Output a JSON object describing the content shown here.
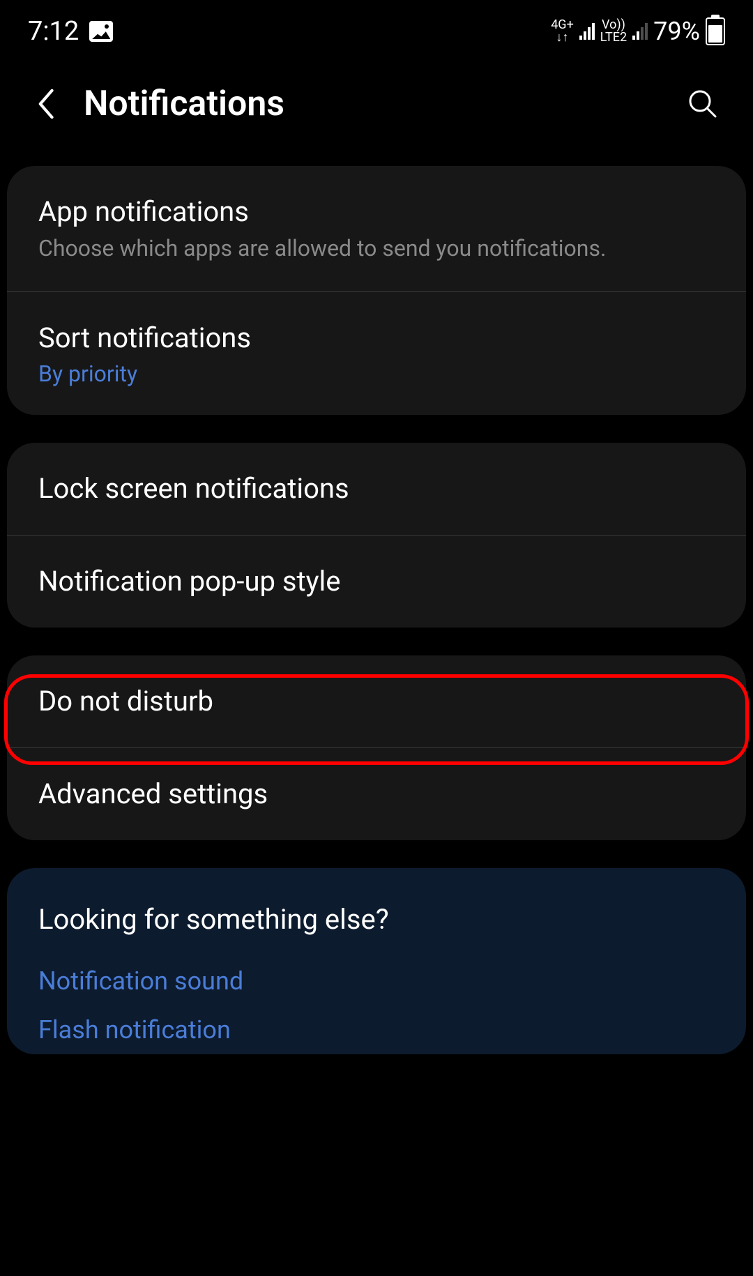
{
  "statusbar": {
    "time": "7:12",
    "network1_label": "4G+",
    "network2_label_top": "Vo))",
    "network2_label_bottom": "LTE2",
    "battery": "79%"
  },
  "header": {
    "title": "Notifications"
  },
  "groups": [
    {
      "items": [
        {
          "title": "App notifications",
          "desc": "Choose which apps are allowed to send you notifications."
        },
        {
          "title": "Sort notifications",
          "value": "By priority"
        }
      ]
    },
    {
      "items": [
        {
          "title": "Lock screen notifications"
        },
        {
          "title": "Notification pop-up style"
        }
      ]
    },
    {
      "items": [
        {
          "title": "Do not disturb"
        },
        {
          "title": "Advanced settings"
        }
      ]
    }
  ],
  "suggestion": {
    "title": "Looking for something else?",
    "links": [
      "Notification sound",
      "Flash notification"
    ]
  }
}
